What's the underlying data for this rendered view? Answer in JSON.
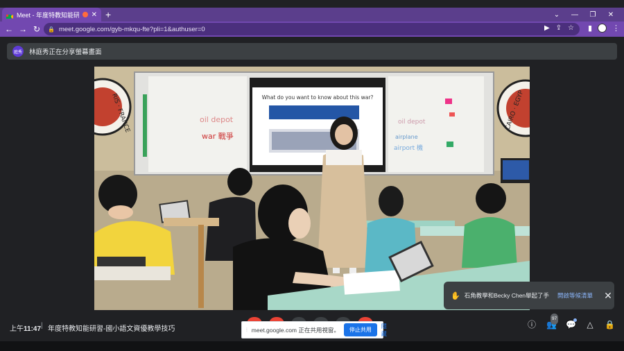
{
  "browser": {
    "tab_title": "Meet - 年度特教知能研習-國",
    "new_tab_symbol": "+",
    "url": "meet.google.com/gyb-mkqu-fte?pli=1&authuser=0"
  },
  "presenting_banner": {
    "avatar_initials": "庭秀",
    "text": "林庭秀正在分享螢幕畫面"
  },
  "slide": {
    "question": "What do you want to know about this war?"
  },
  "whiteboard": {
    "left_words": [
      "oil depot",
      "war 戰爭"
    ],
    "right_words": [
      "oil depot",
      "airplane",
      "airport 機"
    ]
  },
  "emblem_left": "RIS · FRANCE",
  "emblem_right": "CAIRO · EGYP",
  "bottom_bar": {
    "time_prefix": "上午",
    "time": "11:47",
    "separator": "|",
    "meeting_name": "年度特教知能研習-國小語文資優教學技巧",
    "people_count": "97"
  },
  "share_notice": {
    "message": "meet.google.com 正在共用視窗。",
    "stop_label": "停止共用",
    "hide_label": "隱藏"
  },
  "toast": {
    "message": "石角教學和Becky Chen舉起了手",
    "link_label": "開啟等候清單"
  },
  "colors": {
    "chrome_purple": "#7248b0",
    "meet_bg": "#202124",
    "accent_blue": "#1a73e8",
    "end_call_red": "#ea4335"
  }
}
